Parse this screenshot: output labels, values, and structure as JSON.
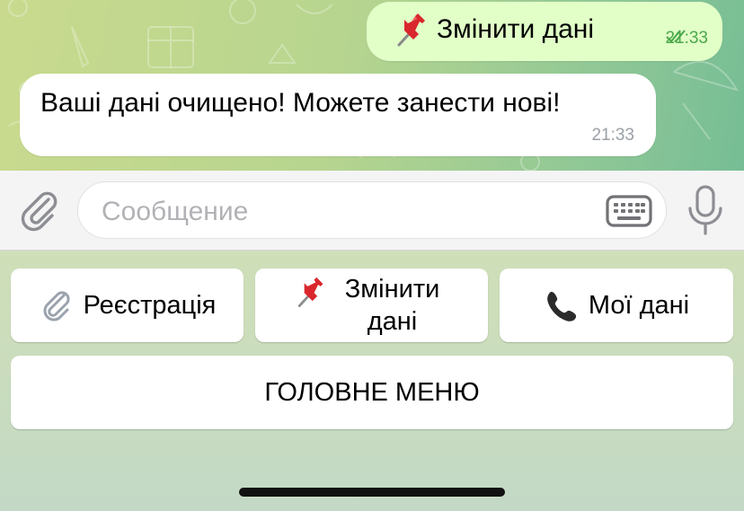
{
  "messages": {
    "outgoing": {
      "text": "Змінити дані",
      "time": "21:33",
      "status": "read-double-check-icon"
    },
    "incoming": {
      "text": "Ваші дані очищено! Можете занести нові!",
      "time": "21:33"
    }
  },
  "composer": {
    "placeholder": "Сообщение"
  },
  "reply_keyboard": {
    "register_label": "Реєстрація",
    "edit_label": "Змінити дані",
    "my_data_label": "Мої дані",
    "main_menu_label": "ГОЛОВНЕ МЕНЮ"
  },
  "colors": {
    "outgoing_bubble": "#e1ffc7",
    "incoming_bubble": "#ffffff",
    "read_check": "#4aa84a"
  }
}
